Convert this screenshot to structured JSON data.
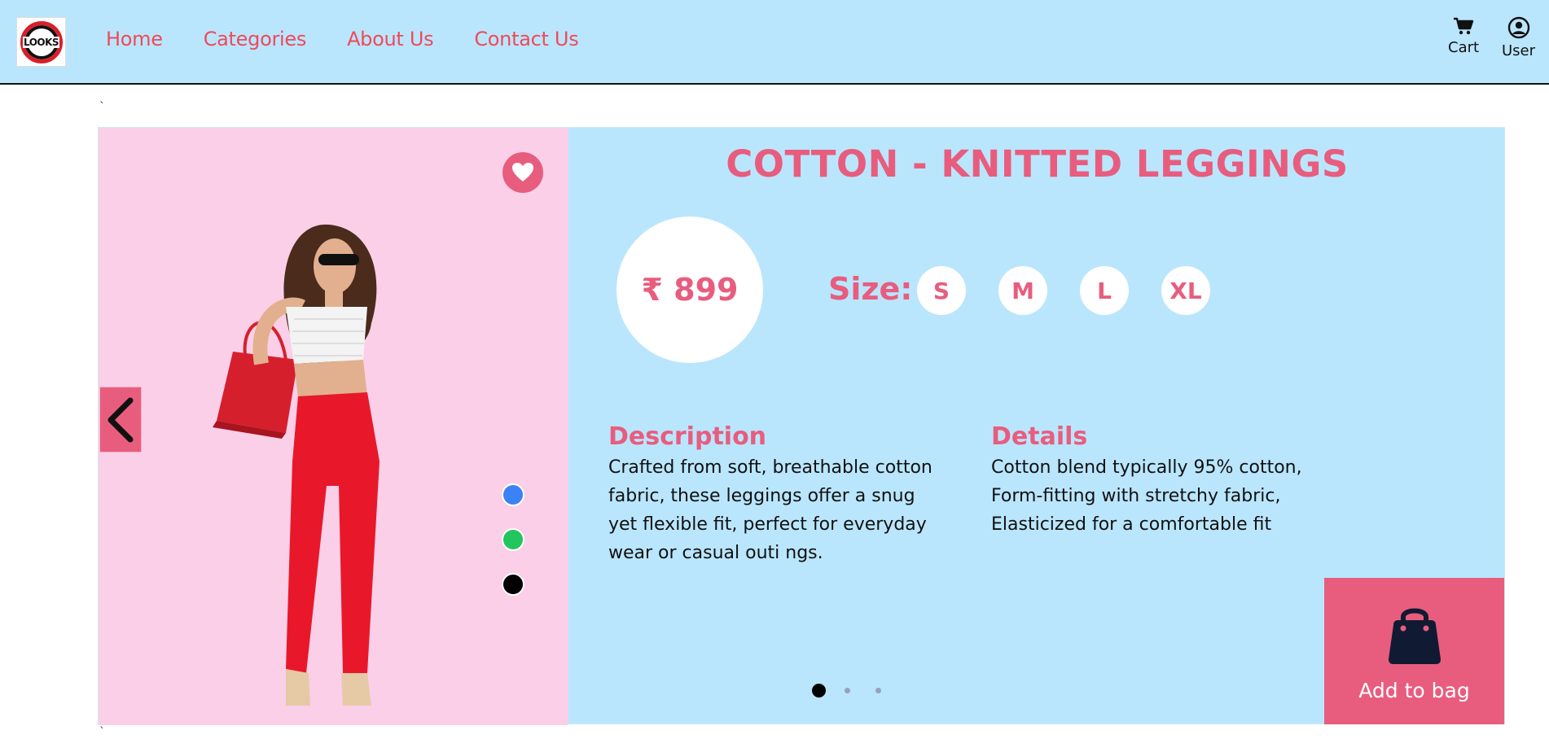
{
  "nav": {
    "logo_text": "LOOKS",
    "links": [
      "Home",
      "Categories",
      "About Us",
      "Contact Us"
    ],
    "cart_label": "Cart",
    "user_label": "User",
    "icons": {
      "cart": "cart-icon",
      "user": "user-icon"
    }
  },
  "page": {
    "stray_char": "`",
    "stray_char_bottom": "`"
  },
  "product": {
    "title": "COTTON - KNITTED LEGGINGS",
    "price": "₹ 899",
    "size_label": "Size:",
    "sizes": [
      "S",
      "M",
      "L",
      "XL"
    ],
    "description_heading": "Description",
    "description_lines": [
      "Crafted from soft, breathable cotton",
      "fabric, these leggings offer a snug",
      "yet flexible fit, perfect for everyday",
      "wear or casual outi ngs."
    ],
    "details_heading": "Details",
    "details_lines": [
      "Cotton blend typically 95% cotton,",
      "Form-fitting with stretchy fabric,",
      "Elasticized for a comfortable fit"
    ],
    "add_to_bag_label": "Add to bag",
    "color_options": [
      "#3b82f6",
      "#22c55e",
      "#000000"
    ],
    "carousel": {
      "slides": 3,
      "active": 1
    }
  },
  "colors": {
    "accent": "#e85d7e",
    "nav_link": "#ef4a5a",
    "panel_blue": "#bae6fd",
    "panel_pink": "#fbcfe8"
  }
}
